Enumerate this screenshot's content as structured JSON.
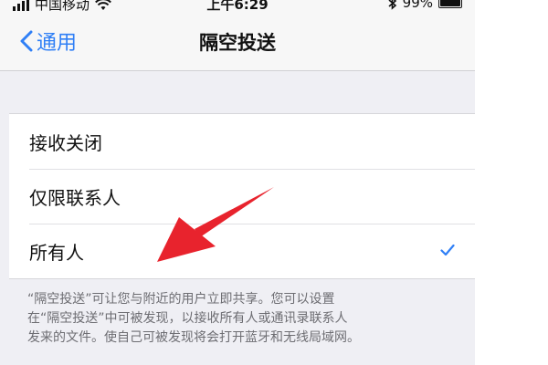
{
  "status_bar": {
    "carrier": "中国移动",
    "time": "上午6:29",
    "battery": "99%",
    "battery_level": 0.99
  },
  "nav": {
    "back_label": "通用",
    "title": "隔空投送"
  },
  "options": [
    {
      "label": "接收关闭",
      "selected": false
    },
    {
      "label": "仅限联系人",
      "selected": false
    },
    {
      "label": "所有人",
      "selected": true
    }
  ],
  "footer": {
    "lines": [
      "“隔空投送”可让您与附近的用户立即共享。您可以设置",
      "在“隔空投送”中可被发现，以接收所有人或通讯录联系人",
      "发来的文件。使自己可被发现将会打开蓝牙和无线局域网。"
    ]
  },
  "colors": {
    "accent": "#2f7ff6",
    "annotation_arrow": "#e8232d",
    "background": "#efeff4"
  },
  "icons": {
    "back": "chevron-left-icon",
    "check": "checkmark-icon",
    "wifi": "wifi-icon",
    "bluetooth": "bluetooth-icon",
    "battery": "battery-icon",
    "signal": "signal-icon"
  }
}
